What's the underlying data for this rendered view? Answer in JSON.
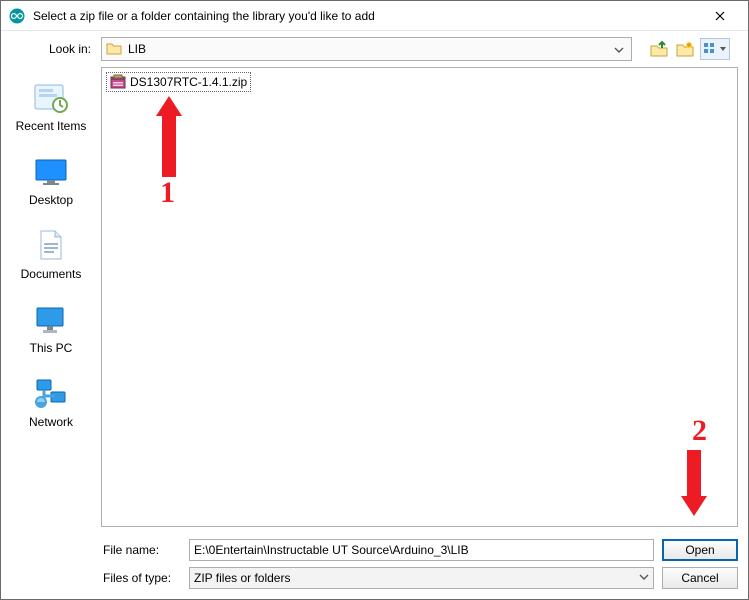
{
  "title": "Select a zip file or a folder containing the library you'd like to add",
  "lookin": {
    "label": "Look in:",
    "value": "LIB"
  },
  "places": {
    "recent": "Recent Items",
    "desktop": "Desktop",
    "documents": "Documents",
    "thispc": "This PC",
    "network": "Network"
  },
  "file": {
    "name": "DS1307RTC-1.4.1.zip"
  },
  "annotations": {
    "one": "1",
    "two": "2"
  },
  "filename": {
    "label": "File name:",
    "value": "E:\\0Entertain\\Instructable UT Source\\Arduino_3\\LIB"
  },
  "filetype": {
    "label": "Files of type:",
    "value": "ZIP files or folders"
  },
  "buttons": {
    "open": "Open",
    "cancel": "Cancel"
  }
}
